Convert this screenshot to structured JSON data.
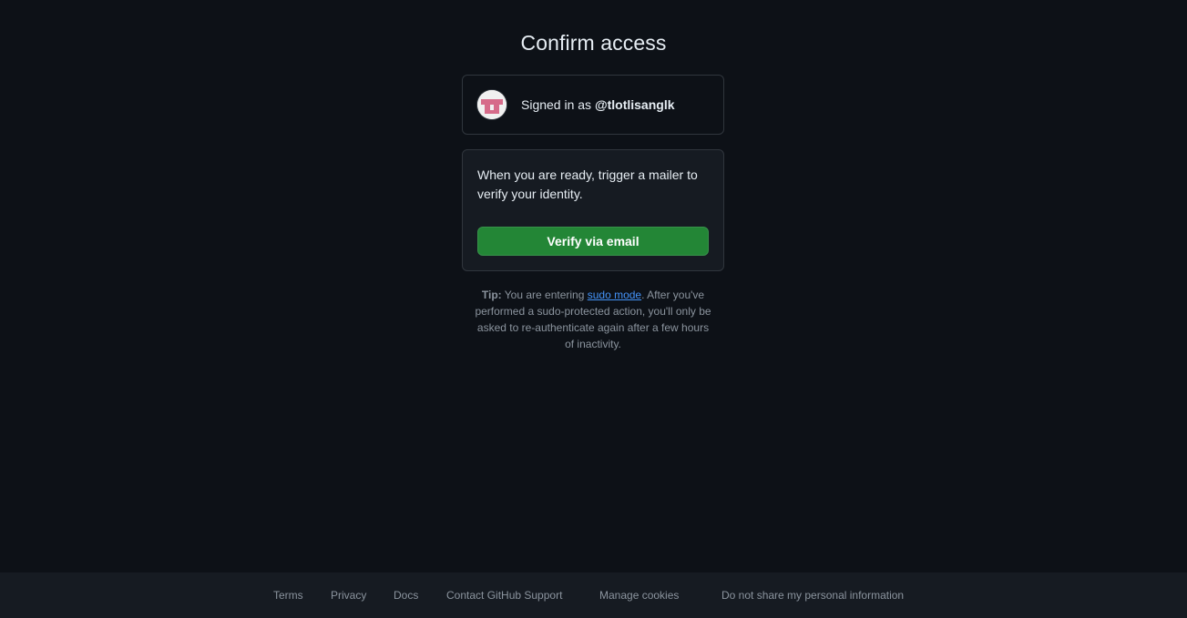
{
  "page": {
    "title": "Confirm access"
  },
  "signed_in": {
    "prefix": "Signed in as ",
    "username": "@tlotlisanglk"
  },
  "verify": {
    "message": "When you are ready, trigger a mailer to verify your identity.",
    "button_label": "Verify via email"
  },
  "tip": {
    "label": "Tip:",
    "before_link": " You are entering ",
    "link_text": "sudo mode",
    "after_link": ". After you've performed a sudo-protected action, you'll only be asked to re-authenticate again after a few hours of inactivity."
  },
  "footer": {
    "links": [
      "Terms",
      "Privacy",
      "Docs",
      "Contact GitHub Support",
      "Manage cookies",
      "Do not share my personal information"
    ]
  },
  "colors": {
    "background": "#0d1117",
    "panel": "#161b22",
    "border": "#30363d",
    "primary_button": "#238636",
    "link": "#4493f8",
    "muted_text": "#8b949e"
  },
  "icons": {
    "avatar": "identicon-avatar"
  }
}
